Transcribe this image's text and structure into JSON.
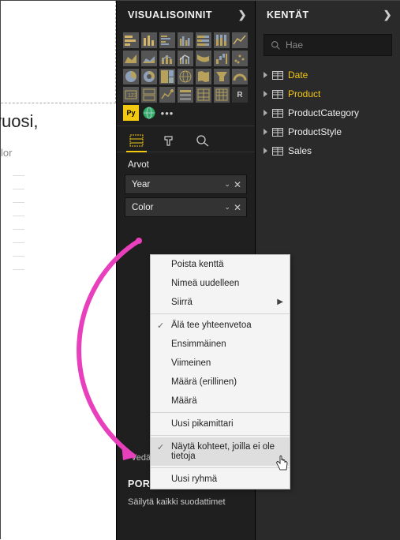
{
  "canvas": {
    "partial_label": "vuosi,",
    "sub_label": "lor"
  },
  "viz": {
    "header": "VISUALISOINNIT",
    "tabs": {
      "fields": "fields",
      "format": "format",
      "analytics": "analytics"
    },
    "section_arvot": "Arvot",
    "wells": [
      {
        "label": "Year"
      },
      {
        "label": "Color"
      }
    ],
    "drop_hint": "Vedä tietokentät tähän",
    "drill_header": "PORAUTUMINEN",
    "drill_sub": "Säilytä kaikki suodattimet"
  },
  "kentat": {
    "header": "KENTÄT",
    "search_placeholder": "Hae",
    "tables": [
      {
        "name": "Date",
        "highlight": true
      },
      {
        "name": "Product",
        "highlight": true
      },
      {
        "name": "ProductCategory",
        "highlight": false
      },
      {
        "name": "ProductStyle",
        "highlight": false
      },
      {
        "name": "Sales",
        "highlight": false
      }
    ]
  },
  "context_menu": {
    "items": [
      {
        "label": "Poista kenttä",
        "type": "item"
      },
      {
        "label": "Nimeä uudelleen",
        "type": "item"
      },
      {
        "label": "Siirrä",
        "type": "submenu"
      },
      {
        "type": "sep"
      },
      {
        "label": "Älä tee yhteenvetoa",
        "type": "item",
        "checked": true
      },
      {
        "label": "Ensimmäinen",
        "type": "item"
      },
      {
        "label": "Viimeinen",
        "type": "item"
      },
      {
        "label": "Määrä (erillinen)",
        "type": "item"
      },
      {
        "label": "Määrä",
        "type": "item"
      },
      {
        "type": "sep"
      },
      {
        "label": "Uusi pikamittari",
        "type": "item"
      },
      {
        "type": "sep"
      },
      {
        "label": "Näytä kohteet, joilla ei ole tietoja",
        "type": "item",
        "checked": true,
        "highlighted": true
      },
      {
        "type": "sep"
      },
      {
        "label": "Uusi ryhmä",
        "type": "item"
      }
    ]
  }
}
